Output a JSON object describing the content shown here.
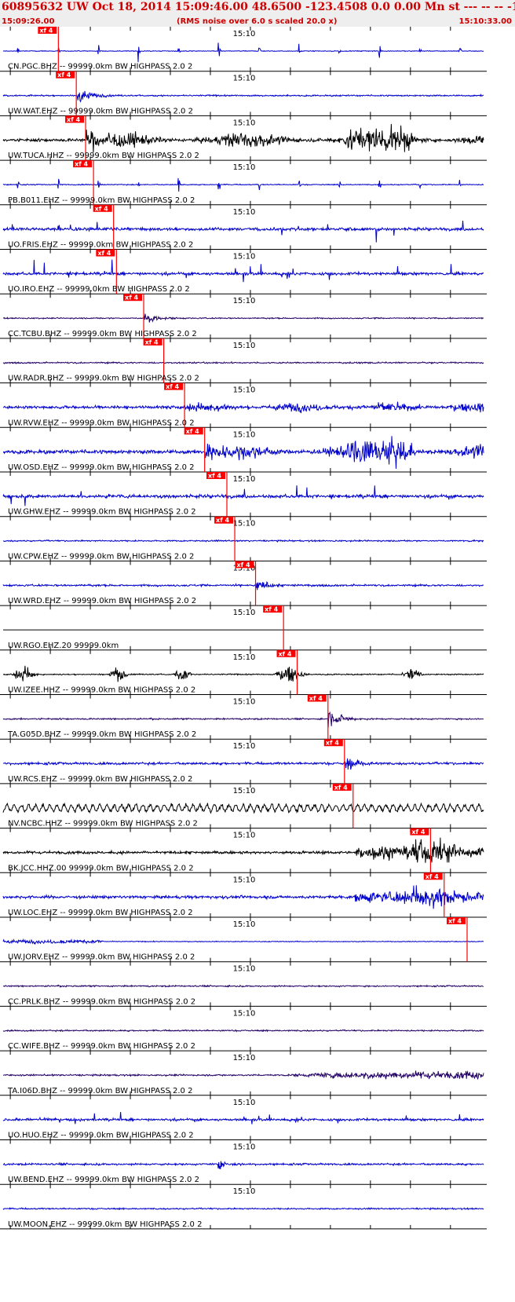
{
  "header": {
    "title": "60895632 UW Oct 18, 2014 15:09:46.00   48.6500 -123.4508  0.0 0.00 Mn st --- -- --  -1",
    "subtitle": "(RMS noise over 6.0 s scaled 20.0 x)",
    "start_time": "15:09:26.00",
    "end_time": "15:10:33.00"
  },
  "colors": {
    "header_text": "#cc0000",
    "pick": "#ff0000",
    "grid": "#000000"
  },
  "chart_data": {
    "type": "line",
    "title": "60895632 UW Oct 18, 2014 15:09:46.00   48.6500 -123.4508  0.0 0.00 Mn st --- -- --  -1",
    "x_range_seconds": [
      0,
      67
    ],
    "minute_tick_label": "15:10",
    "pick_tag": "xf 4",
    "traces": [
      {
        "label": "CN.PGC.BHZ -- 99999.0km BW  HIGHPASS  2.0  2",
        "color": "#0000cc",
        "pick_s": 7.7,
        "style": "pulses",
        "amp": 1.0,
        "noise": 0.03
      },
      {
        "label": "UW.WAT.EHZ -- 99999.0km BW  HIGHPASS  2.0  2",
        "color": "#0000cc",
        "pick_s": 10.2,
        "style": "burst",
        "amp": 0.8,
        "noise": 0.06
      },
      {
        "label": "UW.TUCA.HHZ -- 99999.0km BW  HIGHPASS  2.0  2",
        "color": "#000000",
        "pick_s": 11.5,
        "style": "long",
        "amp": 1.0,
        "noise": 0.12
      },
      {
        "label": "PB.B011.EHZ -- 99999.0km BW  HIGHPASS  2.0  2",
        "color": "#0000cc",
        "pick_s": 12.6,
        "style": "pulses",
        "amp": 0.9,
        "noise": 0.04
      },
      {
        "label": "UO.FRIS.EHZ -- 99999.0km BW  HIGHPASS  2.0  2",
        "color": "#0000cc",
        "pick_s": 15.4,
        "style": "spiky",
        "amp": 0.8,
        "noise": 0.12
      },
      {
        "label": "UO.IRO.EHZ -- 99999.0km BW  HIGHPASS  2.0  2",
        "color": "#0000cc",
        "pick_s": 15.8,
        "style": "spiky",
        "amp": 0.9,
        "noise": 0.12
      },
      {
        "label": "CC.TCBU.BHZ -- 99999.0km BW  HIGHPASS  2.0  2",
        "color": "#220066",
        "pick_s": 19.6,
        "style": "burst",
        "amp": 0.6,
        "noise": 0.05
      },
      {
        "label": "UW.RADR.BHZ -- 99999.0km BW  HIGHPASS  2.0  2",
        "color": "#220066",
        "pick_s": 22.4,
        "style": "quiet",
        "amp": 0.2,
        "noise": 0.06
      },
      {
        "label": "UW.RVW.EHZ -- 99999.0km BW  HIGHPASS  2.0  2",
        "color": "#0000cc",
        "pick_s": 25.3,
        "style": "coda",
        "amp": 0.35,
        "noise": 0.12
      },
      {
        "label": "UW.OSD.EHZ -- 99999.0km BW  HIGHPASS  2.0  2",
        "color": "#0000cc",
        "pick_s": 28.1,
        "style": "long",
        "amp": 1.0,
        "noise": 0.15
      },
      {
        "label": "UW.GHW.EHZ -- 99999.0km BW  HIGHPASS  2.0  2",
        "color": "#0000cc",
        "pick_s": 31.2,
        "style": "spiky",
        "amp": 0.7,
        "noise": 0.14
      },
      {
        "label": "UW.CPW.EHZ -- 99999.0km BW  HIGHPASS  2.0  2",
        "color": "#0000cc",
        "pick_s": 32.3,
        "style": "quiet",
        "amp": 0.3,
        "noise": 0.06
      },
      {
        "label": "UW.WRD.EHZ -- 99999.0km BW  HIGHPASS  2.0  2",
        "color": "#0000cc",
        "pick_s": 35.2,
        "style": "burst",
        "amp": 0.6,
        "noise": 0.08
      },
      {
        "label": "UW.RGO.EHZ.20 99999.0km",
        "color": "#000000",
        "pick_s": 39.1,
        "style": "flat",
        "amp": 0.0,
        "noise": 0.0
      },
      {
        "label": "UW.IZEE.HHZ -- 99999.0km BW  HIGHPASS  2.0  2",
        "color": "#000000",
        "pick_s": 41.0,
        "style": "bursts",
        "amp": 0.7,
        "noise": 0.05
      },
      {
        "label": "TA.G05D.BHZ -- 99999.0km BW  HIGHPASS  2.0  2",
        "color": "#220066",
        "pick_s": 45.3,
        "style": "burst",
        "amp": 0.9,
        "noise": 0.06
      },
      {
        "label": "UW.RCS.EHZ -- 99999.0km BW  HIGHPASS  2.0  2",
        "color": "#0000cc",
        "pick_s": 47.6,
        "style": "burst",
        "amp": 0.8,
        "noise": 0.1
      },
      {
        "label": "NV.NCBC.HHZ -- 99999.0km BW  HIGHPASS  2.0  2",
        "color": "#000000",
        "pick_s": 48.8,
        "style": "wavy",
        "amp": 0.15,
        "noise": 0.15
      },
      {
        "label": "BK.JCC.HHZ.00 99999.0km BW  HIGHPASS  2.0  2",
        "color": "#000000",
        "pick_s": 59.6,
        "style": "late",
        "amp": 1.0,
        "noise": 0.05
      },
      {
        "label": "UW.LOC.EHZ -- 99999.0km BW  HIGHPASS  2.0  2",
        "color": "#0000cc",
        "pick_s": 61.5,
        "style": "late",
        "amp": 0.9,
        "noise": 0.08
      },
      {
        "label": "UW.JORV.EHZ -- 99999.0km BW  HIGHPASS  2.0  2",
        "color": "#0000cc",
        "pick_s": 64.7,
        "style": "early",
        "amp": 0.15,
        "noise": 0.03
      },
      {
        "label": "CC.PRLK.BHZ -- 99999.0km BW  HIGHPASS  2.0  2",
        "color": "#220066",
        "pick_s": null,
        "style": "quiet",
        "amp": 0.1,
        "noise": 0.06
      },
      {
        "label": "CC.WIFE.BHZ -- 99999.0km BW  HIGHPASS  2.0  2",
        "color": "#220066",
        "pick_s": null,
        "style": "quiet",
        "amp": 0.1,
        "noise": 0.06
      },
      {
        "label": "TA.I06D.BHZ -- 99999.0km BW  HIGHPASS  2.0  2",
        "color": "#220066",
        "pick_s": null,
        "style": "growing",
        "amp": 0.3,
        "noise": 0.06
      },
      {
        "label": "UO.HUO.EHZ -- 99999.0km BW  HIGHPASS  2.0  2",
        "color": "#0000cc",
        "pick_s": null,
        "style": "spiky",
        "amp": 0.5,
        "noise": 0.1
      },
      {
        "label": "UW.BEND.EHZ -- 99999.0km BW  HIGHPASS  2.0  2",
        "color": "#0000cc",
        "pick_s": null,
        "style": "burst",
        "amp": 0.4,
        "noise": 0.08
      },
      {
        "label": "UW.MOON.EHZ -- 99999.0km BW  HIGHPASS  2.0  2",
        "color": "#0000cc",
        "pick_s": null,
        "style": "quiet",
        "amp": 0.15,
        "noise": 0.06
      }
    ]
  }
}
